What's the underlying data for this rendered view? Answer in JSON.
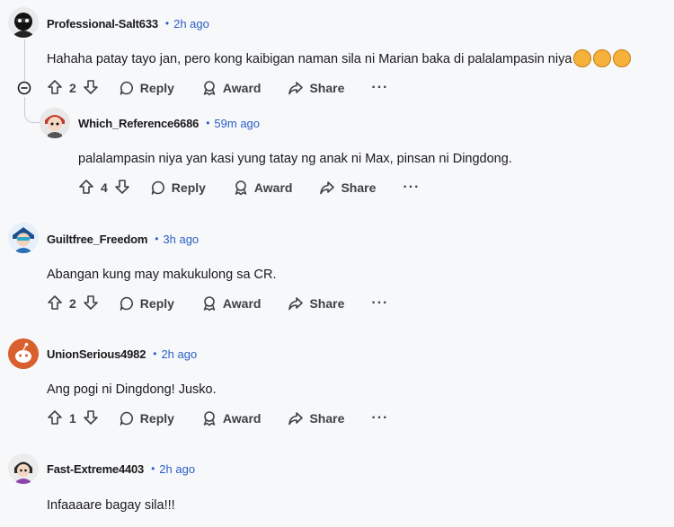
{
  "comments": [
    {
      "username": "Professional-Salt633",
      "time": "2h ago",
      "text": "Hahaha patay tayo jan, pero kong kaibigan naman sila ni Marian baka di palalampasin niya",
      "votes": "2"
    },
    {
      "username": "Which_Reference6686",
      "time": "59m ago",
      "text": "palalampasin niya yan kasi yung tatay ng anak ni Max, pinsan ni Dingdong.",
      "votes": "4"
    },
    {
      "username": "Guiltfree_Freedom",
      "time": "3h ago",
      "text": "Abangan kung may makukulong sa CR.",
      "votes": "2"
    },
    {
      "username": "UnionSerious4982",
      "time": "2h ago",
      "text": "Ang pogi ni Dingdong! Jusko.",
      "votes": "1"
    },
    {
      "username": "Fast-Extreme4403",
      "time": "2h ago",
      "text": "Infaaaare bagay sila!!!",
      "votes": ""
    }
  ],
  "labels": {
    "dot": "•",
    "reply": "Reply",
    "award": "Award",
    "share": "Share",
    "more": "···"
  },
  "emoji": [
    "rofl-emoji",
    "joy-emoji",
    "rofl-emoji"
  ],
  "colors": {
    "timestamp": "#2b5ec7",
    "background": "#f7f8fa",
    "thread_line": "#c7cbd1"
  }
}
